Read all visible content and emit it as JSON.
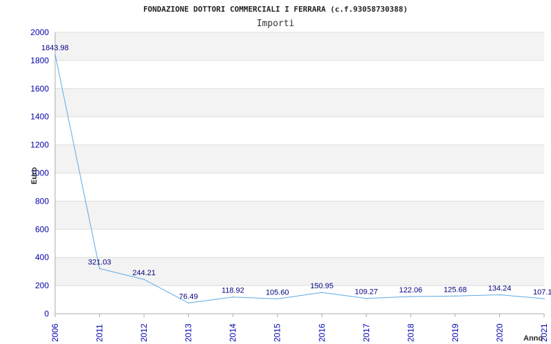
{
  "chart_data": {
    "type": "line",
    "title": "FONDAZIONE DOTTORI COMMERCIALI I FERRARA (c.f.93058730388)",
    "subtitle": "Importi",
    "xlabel": "Anno",
    "ylabel": "Euro",
    "ylim": [
      0,
      2000
    ],
    "yticks": [
      0,
      200,
      400,
      600,
      800,
      1000,
      1200,
      1400,
      1600,
      1800,
      2000
    ],
    "grid": "horizontal bands",
    "categories": [
      "2006",
      "2011",
      "2012",
      "2013",
      "2014",
      "2015",
      "2016",
      "2017",
      "2018",
      "2019",
      "2020",
      "2021"
    ],
    "values": [
      1843.98,
      321.03,
      244.21,
      76.49,
      118.92,
      105.6,
      150.95,
      109.27,
      122.06,
      125.68,
      134.24,
      107.1
    ],
    "data_labels": [
      "1843.98",
      "321.03",
      "244.21",
      "76.49",
      "118.92",
      "105.60",
      "150.95",
      "109.27",
      "122.06",
      "125.68",
      "134.24",
      "107.1"
    ],
    "colors": {
      "line": "#5aa9e6",
      "band": "#f3f3f3",
      "tick_text": "#0000aa",
      "label_text": "#000080"
    }
  }
}
